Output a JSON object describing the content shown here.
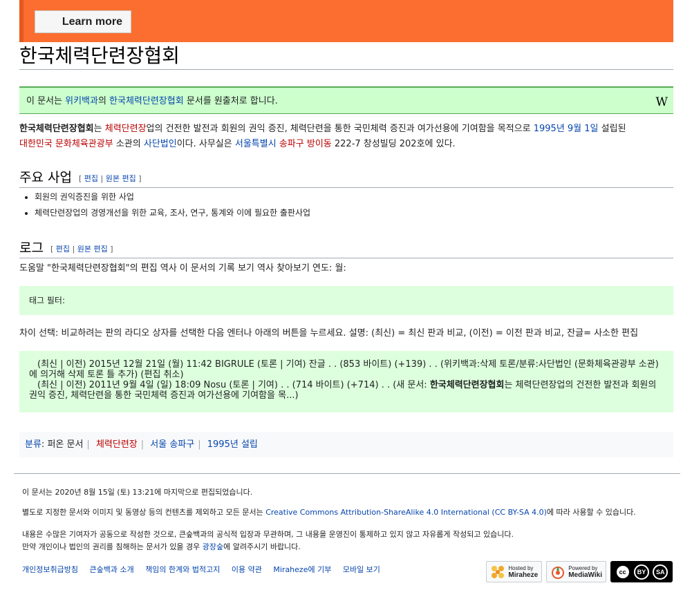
{
  "banner": {
    "learn_more": "Learn more",
    "color": "#fc6e2f"
  },
  "page": {
    "title": "한국체력단련장협회"
  },
  "source_notice": {
    "prefix": "이 문서는 ",
    "wikipedia": "위키백과",
    "mid": "의 ",
    "article_link": "한국체력단련장협회",
    "suffix": " 문서를 원출처로 합니다.",
    "icon": "W"
  },
  "intro": {
    "bold_name": "한국체력단련장협회",
    "t1": "는 ",
    "link_gym": "체력단련장",
    "t2": "업의 건전한 발전과 회원의 권익 증진, 체력단련을 통한 국민체력 증진과 여가선용에 기여함을 목적으로 ",
    "link_date": "1995년 9월 1일",
    "t3": " 설립된",
    "link_ministry": "대한민국 문화체육관광부",
    "t4": " 소관의 ",
    "link_corp": "사단법인",
    "t5": "이다. 사무실은 ",
    "link_seoul": "서울특별시",
    "t6": " ",
    "link_songpa": "송파구",
    "t7": " ",
    "link_bangi": "방이동",
    "t8": " 222-7 창성빌딩 202호에 있다."
  },
  "sections": {
    "business": {
      "heading": "주요 사업",
      "edit_open": "[ ",
      "edit": "편집",
      "sep": " | ",
      "edit_source": "원본 편집",
      "edit_close": " ]",
      "items": [
        "회원의 권익증진을 위한 사업",
        "체력단련장업의 경영개선을 위한 교육, 조사, 연구, 통계와 이에 필요한 출판사업"
      ]
    },
    "log": {
      "heading": "로그",
      "edit_open": "[ ",
      "edit": "편집",
      "sep": " | ",
      "edit_source": "원본 편집",
      "edit_close": " ]",
      "help_line": "도움말 \"한국체력단련장협회\"의 편집 역사 이 문서의 기록 보기 역사 찾아보기 연도: 월:",
      "filter_label": "태그 필터:",
      "diff_help": "차이 선택: 비교하려는 판의 라디오 상자를 선택한 다음 엔터나 아래의 버튼을 누르세요. 설명: (최신) = 최신 판과 비교, (이전) = 이전 판과 비교, 잔글= 사소한 편집",
      "history": [
        "(최신 | 이전) 2015년 12월 21일 (월) 11:42 BIGRULE (토론 | 기여) 잔글 . . (853 바이트) (+139) . . (위키백과:삭제 토론/분류:사단법인 (문화체육관광부 소관)에 의거해 삭제 토론 틀 추가) (편집 취소)",
        "(최신 | 이전) 2011년 9월 4일 (일) 18:09 Nosu (토론 | 기여) . . (714 바이트) (+714) . . (새 문서: "
      ],
      "history2_bold": "한국체력단련장협회",
      "history2_tail": "는 체력단련장업의 건전한 발전과 회원의 권익 증진, 체력단련을 통한 국민체력 증진과 여가선용에 기여함을 목...)"
    }
  },
  "categories": {
    "label": "분류",
    "colon": ": ",
    "items": [
      "퍼온 문서",
      "체력단련장",
      "서울 송파구",
      "1995년 설립"
    ]
  },
  "footer": {
    "last_edited": "이 문서는 2020년 8월 15일 (토) 13:21에 마지막으로 편집되었습니다.",
    "license_pre": "별도로 지정한 문서와 이미지 및 동영상 등의 컨텐츠를 제외하고 모든 문서는 ",
    "license_link": "Creative Commons Attribution-ShareAlike 4.0 International (CC BY-SA 4.0)",
    "license_post": "에 따라 사용할 수 있습니다.",
    "disclaimer1": "내용은 수많은 기여자가 공동으로 작성한 것으로, 큰숲백과의 공식적 입장과 무관하며, 그 내용을 운영진이 통제하고 있지 않고 자유롭게 작성되고 있습니다.",
    "disclaimer2_pre": "만약 개인이나 법인의 권리를 침해하는 문서가 있을 경우 ",
    "disclaimer2_link": "광장숲",
    "disclaimer2_post": "에 알려주시기 바랍니다.",
    "links": [
      "개인정보취급방침",
      "큰숲백과 소개",
      "책임의 한계와 법적고지",
      "이용 약관",
      "Miraheze에 기부",
      "모바일 보기"
    ],
    "badge_miraheze": {
      "top": "Hosted by",
      "name": "Miraheze"
    },
    "badge_mediawiki": {
      "top": "Powered by",
      "name": "MediaWiki"
    },
    "cc_badge": {
      "cc": "cc",
      "by": "BY",
      "sa": "SA"
    }
  }
}
